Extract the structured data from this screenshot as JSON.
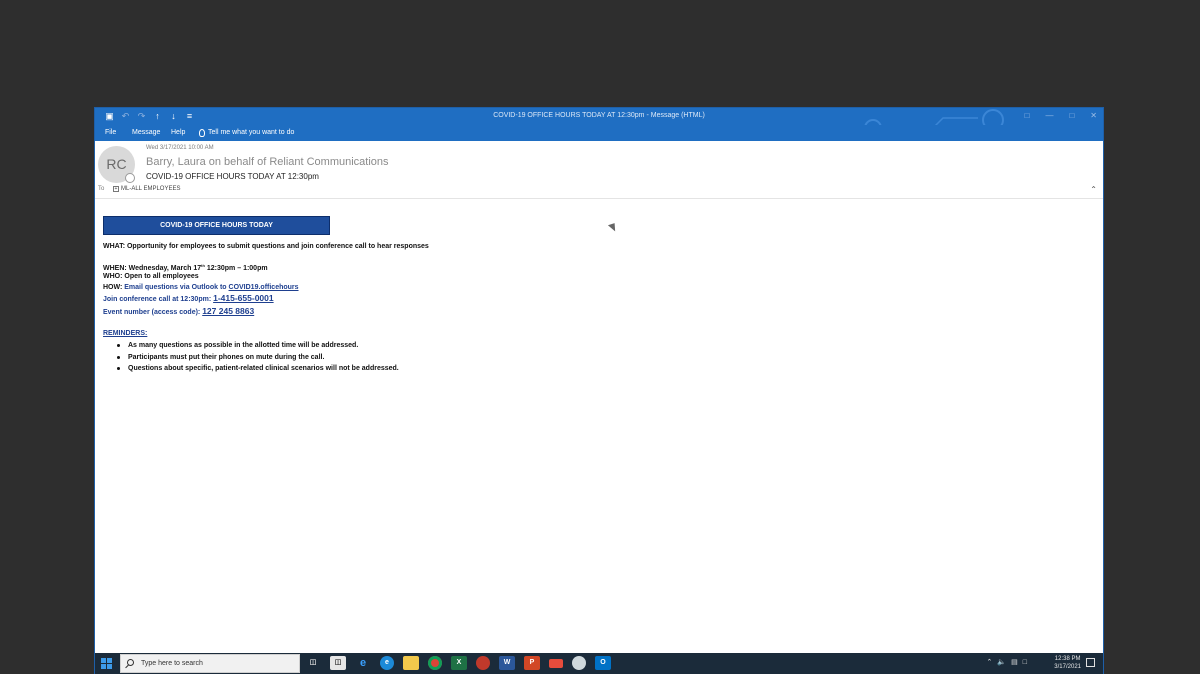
{
  "window": {
    "title": "COVID-19 OFFICE HOURS TODAY AT 12:30pm  -  Message (HTML)",
    "quick_access": [
      "save-icon",
      "undo-icon",
      "redo-icon",
      "up-arrow-icon",
      "down-arrow-icon",
      "customize-icon"
    ]
  },
  "ribbon": {
    "tabs": [
      "File",
      "Message",
      "Help"
    ],
    "tell_me": "Tell me what you want to do"
  },
  "message": {
    "avatar_initials": "RC",
    "date": "Wed 3/17/2021 10:00 AM",
    "sender": "Barry, Laura on behalf of Reliant Communications",
    "subject": "COVID-19 OFFICE HOURS TODAY AT 12:30pm",
    "to_label": "To",
    "to_value": "ML-ALL EMPLOYEES"
  },
  "body": {
    "banner": "COVID-19 OFFICE HOURS TODAY",
    "what": "WHAT: Opportunity for employees to submit questions and join conference call to hear responses",
    "when_prefix": "WHEN: Wednesday, March 17",
    "when_sup": "th",
    "when_suffix": "  12:30pm – 1:00pm",
    "who": "WHO: Open to all employees",
    "how_prefix": "HOW: ",
    "how_text": "Email questions via Outlook to ",
    "how_link": "COVID19.officehours",
    "join_text": "Join conference call at 12:30pm: ",
    "join_link": "1-415-655-0001",
    "event_text": "Event number (access code): ",
    "event_link": "127 245 8863",
    "reminders_title": "REMINDERS:",
    "reminders": [
      "As many questions as possible in the allotted time will be addressed.",
      "Participants must put their phones on mute during the call.",
      "Questions about specific, patient-related clinical scenarios will not be addressed."
    ]
  },
  "taskbar": {
    "search_placeholder": "Type here to search",
    "time": "12:38 PM",
    "date": "3/17/2021",
    "apps": [
      "task-view-icon",
      "store-icon",
      "ie-icon",
      "edge-icon",
      "file-explorer-icon",
      "chrome-icon",
      "excel-icon",
      "app-icon",
      "word-icon",
      "powerpoint-icon",
      "app-icon-2",
      "app-icon-3",
      "outlook-icon"
    ]
  }
}
